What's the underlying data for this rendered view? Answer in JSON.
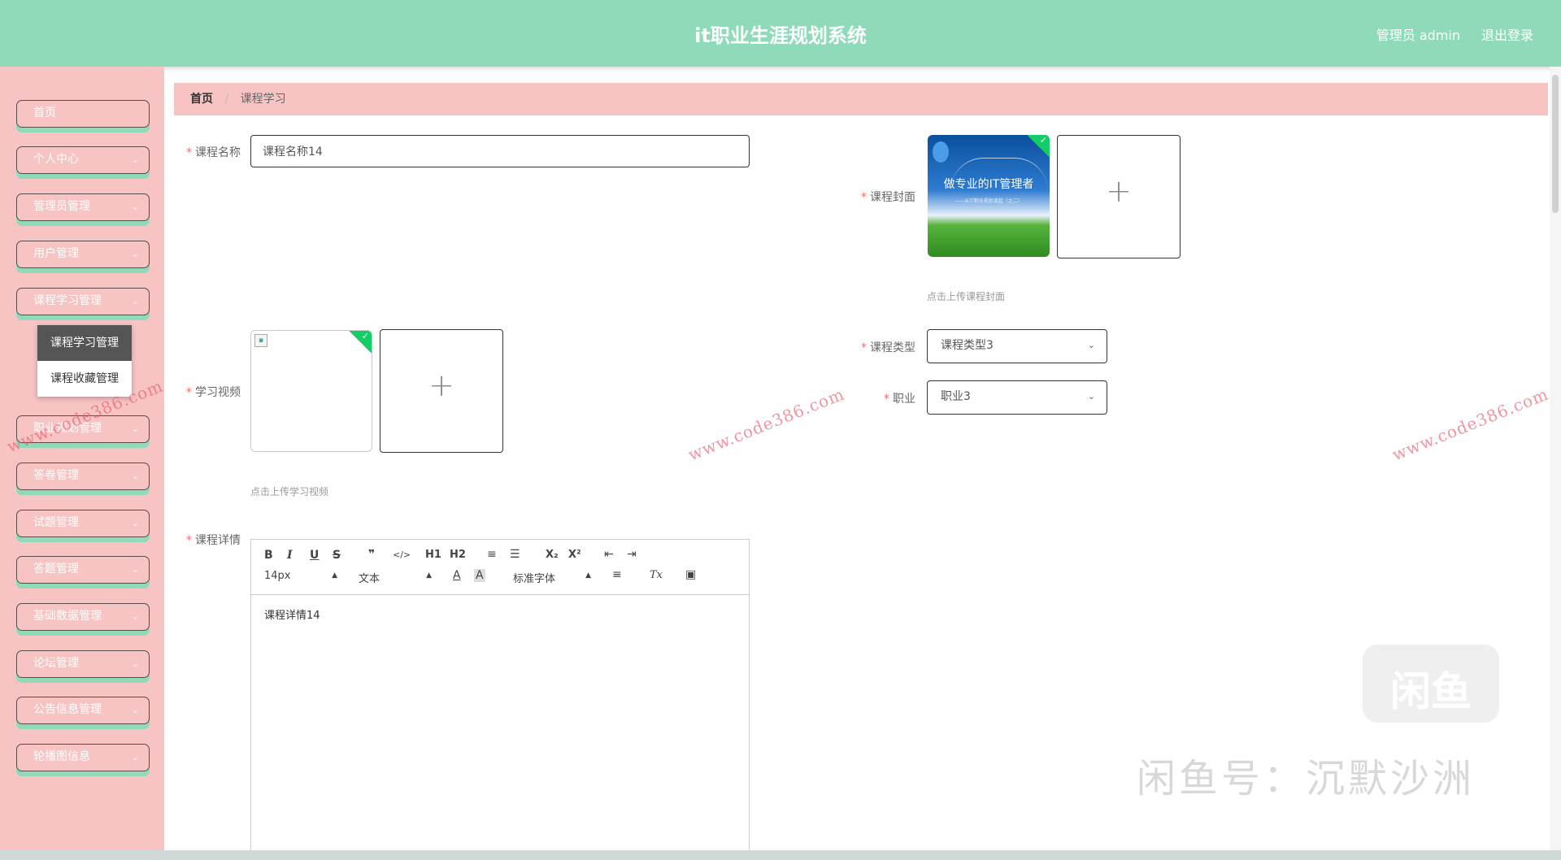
{
  "header": {
    "title": "it职业生涯规划系统",
    "user": "管理员 admin",
    "logout": "退出登录"
  },
  "sidebar": {
    "items": [
      {
        "label": "首页",
        "chevron": false
      },
      {
        "label": "个人中心",
        "chevron": true
      },
      {
        "label": "管理员管理",
        "chevron": true
      },
      {
        "label": "用户管理",
        "chevron": true
      },
      {
        "label": "课程学习管理",
        "chevron": true
      },
      {
        "label": "职业规划管理",
        "chevron": true
      },
      {
        "label": "答卷管理",
        "chevron": true
      },
      {
        "label": "试题管理",
        "chevron": true
      },
      {
        "label": "答题管理",
        "chevron": true
      },
      {
        "label": "基础数据管理",
        "chevron": true
      },
      {
        "label": "论坛管理",
        "chevron": true
      },
      {
        "label": "公告信息管理",
        "chevron": true
      },
      {
        "label": "轮播图信息",
        "chevron": true
      }
    ],
    "submenu": [
      "课程学习管理",
      "课程收藏管理"
    ]
  },
  "breadcrumb": {
    "home": "首页",
    "current": "课程学习"
  },
  "form": {
    "course_name_label": "课程名称",
    "course_name_value": "课程名称14",
    "cover_label": "课程封面",
    "cover_image_title": "做专业的IT管理者",
    "cover_image_sub": "——从IT职业规划谈起（之二）",
    "cover_hint": "点击上传课程封面",
    "video_label": "学习视频",
    "video_hint": "点击上传学习视频",
    "type_label": "课程类型",
    "type_value": "课程类型3",
    "career_label": "职业",
    "career_value": "职业3",
    "detail_label": "课程详情",
    "plus": "+",
    "check": "✓"
  },
  "editor": {
    "buttons": [
      "B",
      "I",
      "U",
      "S",
      "❞",
      "</>",
      "H1",
      "H2",
      "≡",
      "☰",
      "X₂",
      "X²",
      "⇤",
      "⇥"
    ],
    "size": "14px",
    "header": "文本",
    "font": "标准字体",
    "color_icon": "A",
    "bg_icon": "A",
    "align_icon": "≡",
    "clean_icon": "Tx",
    "image_icon": "▣",
    "content": "课程详情14"
  },
  "watermarks": [
    "www.code386.com",
    "www.code386.com",
    "www.code386.com"
  ],
  "xianyu": {
    "logo": "闲鱼",
    "name": "闲鱼号：沉默沙洲"
  }
}
